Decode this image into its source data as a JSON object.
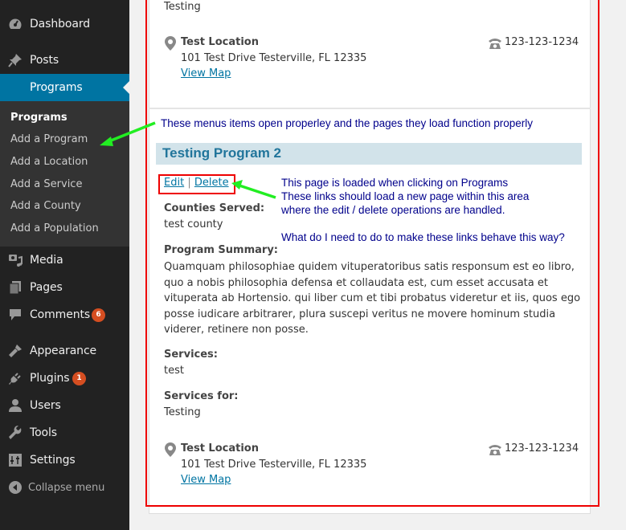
{
  "sidebar": {
    "items": [
      {
        "label": "Dashboard",
        "icon": "dashboard-icon"
      },
      {
        "label": "Posts",
        "icon": "pin-icon"
      },
      {
        "label": "Programs",
        "icon": "none",
        "active": true
      },
      {
        "label": "Media",
        "icon": "media-icon"
      },
      {
        "label": "Pages",
        "icon": "pages-icon"
      },
      {
        "label": "Comments",
        "icon": "comment-icon",
        "badge": "6"
      },
      {
        "label": "Appearance",
        "icon": "brush-icon"
      },
      {
        "label": "Plugins",
        "icon": "plug-icon",
        "badge": "1"
      },
      {
        "label": "Users",
        "icon": "user-icon"
      },
      {
        "label": "Tools",
        "icon": "wrench-icon"
      },
      {
        "label": "Settings",
        "icon": "settings-icon"
      }
    ],
    "submenu": [
      {
        "label": "Programs",
        "current": true
      },
      {
        "label": "Add a Program"
      },
      {
        "label": "Add a Location"
      },
      {
        "label": "Add a Service"
      },
      {
        "label": "Add a County"
      },
      {
        "label": "Add a Population"
      }
    ],
    "collapse_label": "Collapse menu"
  },
  "content": {
    "top_partial_text": "Testing",
    "location1": {
      "name": "Test Location",
      "address": "101 Test Drive Testerville, FL 12335",
      "map_link": "View Map",
      "phone": "123-123-1234"
    },
    "program": {
      "title": "Testing Program 2",
      "edit_label": "Edit",
      "separator": "|",
      "delete_label": "Delete",
      "counties_label": "Counties Served:",
      "counties_value": "test county",
      "summary_label": "Program Summary:",
      "summary_text": "Quamquam philosophiae quidem vituperatoribus satis responsum est eo libro, quo a nobis philosophia defensa et collaudata est, cum esset accusata et vituperata ab Hortensio. qui liber cum et tibi probatus videretur et iis, quos ego posse iudicare arbitrarer, plura suscepi veritus ne movere hominum studia viderer, retinere non posse.",
      "services_label": "Services:",
      "services_value": "test",
      "services_for_label": "Services for:",
      "services_for_value": "Testing"
    },
    "location2": {
      "name": "Test Location",
      "address": "101 Test Drive Testerville, FL 12335",
      "map_link": "View Map",
      "phone": "123-123-1234"
    }
  },
  "annotations": {
    "menu_note": "These menus items open properley and the pages they load function properly",
    "links_note": [
      "This page is loaded when clicking on Programs",
      "These links should load a new page within this area",
      "where the edit / delete operations are handled."
    ],
    "question": "What do I need to do to make these links behave this way?",
    "colors": {
      "annotation_text": "#00008b",
      "arrow": "#22ee22",
      "highlight_box": "#ee0000"
    }
  }
}
